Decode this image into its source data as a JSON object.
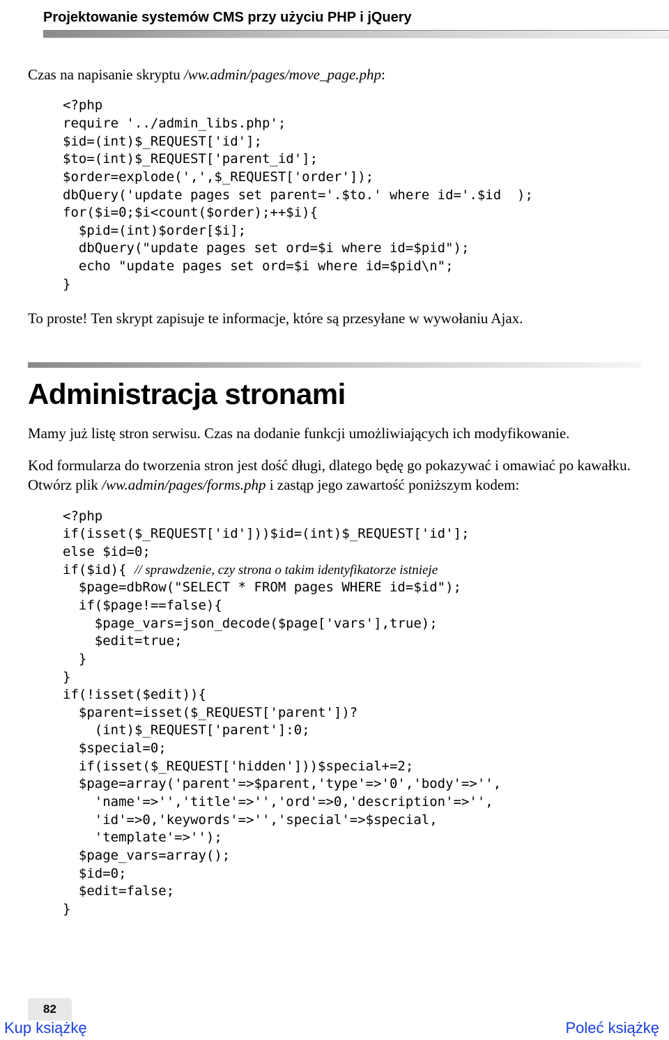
{
  "header": {
    "title": "Projektowanie systemów CMS przy użyciu PHP i jQuery"
  },
  "p1": {
    "pre": "Czas na napisanie skryptu ",
    "path": "/ww.admin/pages/move_page.php",
    "post": ":"
  },
  "code1": "<?php\nrequire '../admin_libs.php';\n$id=(int)$_REQUEST['id'];\n$to=(int)$_REQUEST['parent_id'];\n$order=explode(',',$_REQUEST['order']);\ndbQuery('update pages set parent='.$to.' where id='.$id  );\nfor($i=0;$i<count($order);++$i){\n  $pid=(int)$order[$i];\n  dbQuery(\"update pages set ord=$i where id=$pid\");\n  echo \"update pages set ord=$i where id=$pid\\n\";\n}",
  "p2": "To proste! Ten skrypt zapisuje te informacje, które są przesyłane w wywołaniu Ajax.",
  "section": {
    "title": "Administracja stronami"
  },
  "p3": "Mamy już listę stron serwisu. Czas na dodanie funkcji umożliwiających ich modyfikowanie.",
  "p4": {
    "a": "Kod formularza do tworzenia stron jest dość długi, dlatego będę go pokazywać i omawiać po kawałku. Otwórz plik ",
    "b": "/ww.admin/pages/forms.php",
    "c": " i zastąp jego zawartość poniższym kodem:"
  },
  "code2_a": "<?php\nif(isset($_REQUEST['id']))$id=(int)$_REQUEST['id'];\nelse $id=0;\nif($id){ ",
  "code2_cmt": "// sprawdzenie, czy strona o takim identyfikatorze istnieje",
  "code2_b": "\n  $page=dbRow(\"SELECT * FROM pages WHERE id=$id\");\n  if($page!==false){\n    $page_vars=json_decode($page['vars'],true);\n    $edit=true;\n  }\n}\nif(!isset($edit)){\n  $parent=isset($_REQUEST['parent'])?\n    (int)$_REQUEST['parent']:0;\n  $special=0;\n  if(isset($_REQUEST['hidden']))$special+=2;\n  $page=array('parent'=>$parent,'type'=>'0','body'=>'',\n    'name'=>'','title'=>'','ord'=>0,'description'=>'',\n    'id'=>0,'keywords'=>'','special'=>$special,\n    'template'=>'');\n  $page_vars=array();\n  $id=0;\n  $edit=false;\n}",
  "footer": {
    "page": "82",
    "left": "Kup książkę",
    "right": "Poleć książkę"
  }
}
